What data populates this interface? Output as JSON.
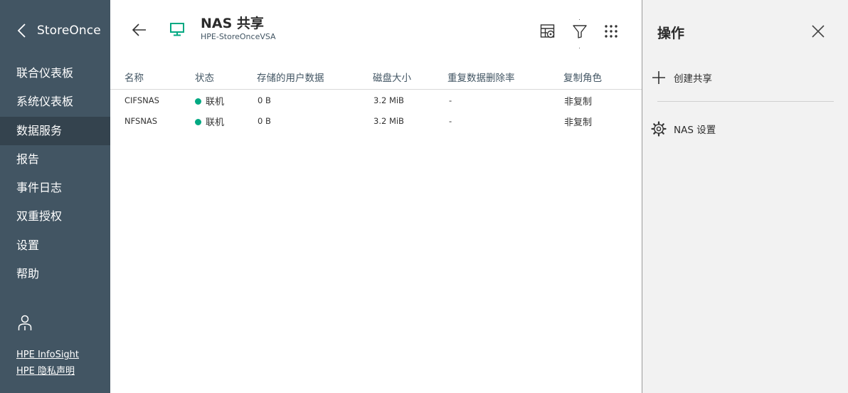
{
  "sidebar": {
    "brand": "StoreOnce",
    "items": [
      {
        "label": "联合仪表板",
        "active": false
      },
      {
        "label": "系统仪表板",
        "active": false
      },
      {
        "label": "数据服务",
        "active": true
      },
      {
        "label": "报告",
        "active": false
      },
      {
        "label": "事件日志",
        "active": false
      },
      {
        "label": "双重授权",
        "active": false
      },
      {
        "label": "设置",
        "active": false
      },
      {
        "label": "帮助",
        "active": false
      }
    ],
    "links": {
      "infosight": "HPE InfoSight",
      "privacy": "HPE 隐私声明"
    },
    "user_icon": "user-icon"
  },
  "header": {
    "title": "NAS 共享",
    "subtitle": "HPE-StoreOnceVSA",
    "icons": [
      "back-arrow-icon",
      "monitor-icon",
      "table-settings-icon",
      "filter-icon",
      "grid-icon"
    ]
  },
  "table": {
    "columns": [
      "名称",
      "状态",
      "存储的用户数据",
      "磁盘大小",
      "重复数据删除率",
      "复制角色"
    ],
    "rows": [
      {
        "name": "CIFSNAS",
        "status": "联机",
        "user_data": "0 B",
        "disk_size": "3.2 MiB",
        "dedupe": "-",
        "role": "非复制"
      },
      {
        "name": "NFSNAS",
        "status": "联机",
        "user_data": "0 B",
        "disk_size": "3.2 MiB",
        "dedupe": "-",
        "role": "非复制"
      }
    ]
  },
  "actions": {
    "title": "操作",
    "create_share": "创建共享",
    "nas_settings": "NAS 设置"
  },
  "colors": {
    "sidebar_bg": "#425563",
    "sidebar_active": "#34434e",
    "accent_green": "#01a982",
    "actions_bg": "#f2f2f2"
  }
}
